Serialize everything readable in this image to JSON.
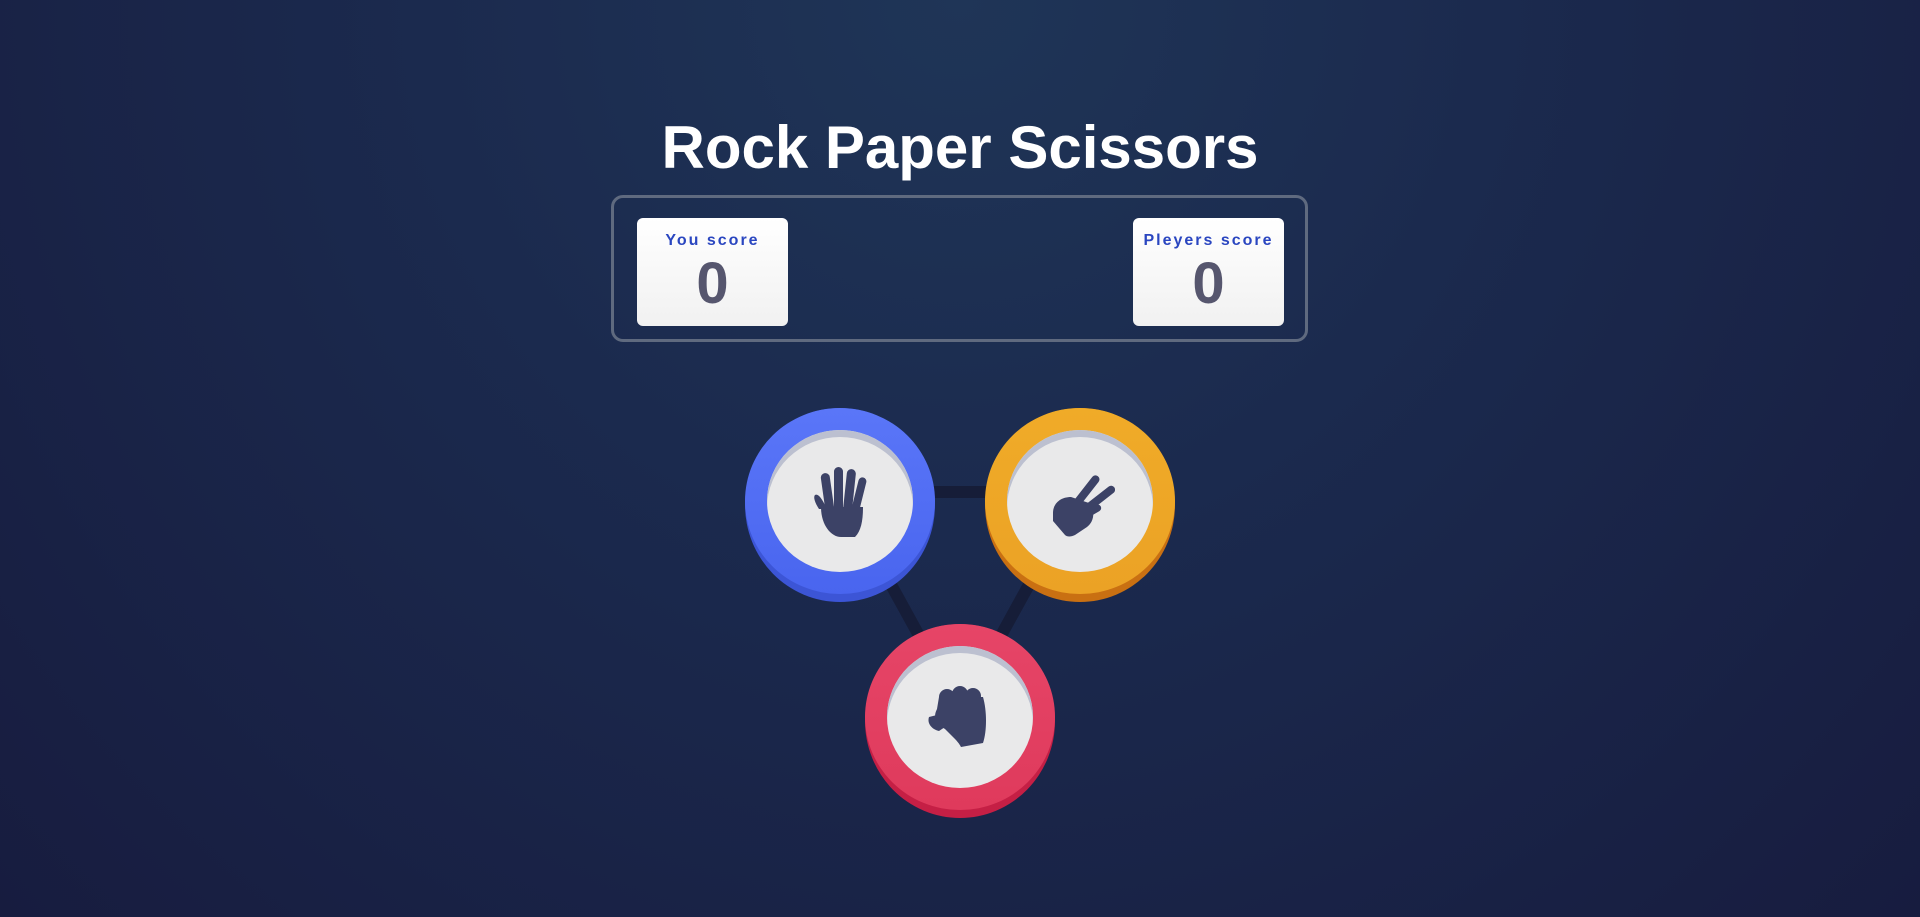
{
  "title": "Rock Paper Scissors",
  "scoreboard": {
    "you": {
      "label": "You score",
      "value": "0"
    },
    "players": {
      "label": "Pleyers score",
      "value": "0"
    }
  },
  "choices": [
    {
      "id": "paper",
      "icon": "paper-hand-icon",
      "color": "#4f6cf5"
    },
    {
      "id": "scissors",
      "icon": "scissors-hand-icon",
      "color": "#eda626"
    },
    {
      "id": "rock",
      "icon": "rock-fist-icon",
      "color": "#e03e60"
    }
  ],
  "colors": {
    "text_accent": "#2a46c0",
    "score_value": "#56566e",
    "icon": "#3c4266"
  }
}
